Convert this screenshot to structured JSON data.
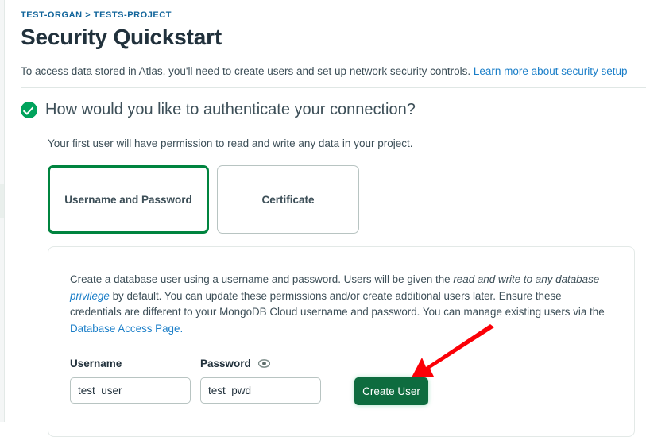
{
  "breadcrumb": {
    "text": "TEST-ORGAN > TESTS-PROJECT",
    "org": "TEST-ORGAN",
    "separator": ">",
    "project": "TESTS-PROJECT",
    "color": "#12659b"
  },
  "header": {
    "title": "Security Quickstart",
    "subtitle_text": "To access data stored in Atlas, you'll need to create users and set up network security controls.",
    "subtitle_link": "Learn more about security setup"
  },
  "section": {
    "status_icon": "check-circle-icon",
    "status_color": "#00a35c",
    "title": "How would you like to authenticate your connection?",
    "description": "Your first user will have permission to read and write any data in your project."
  },
  "auth_options": [
    {
      "label": "Username and Password",
      "selected": true,
      "border_color": "#00843f"
    },
    {
      "label": "Certificate",
      "selected": false,
      "border_color": "#b8c4c2"
    }
  ],
  "panel": {
    "paragraph": {
      "part1": "Create a database user using a username and password. Users will be given the ",
      "italic_link_prefix": "read and write to any database ",
      "italic_link": "privilege",
      "part2": " by default. You can update these permissions and/or create additional users later. Ensure these credentials are different to your MongoDB Cloud username and password. You can manage existing users via the ",
      "link2": "Database Access Page.",
      "link_color": "#1a7ec8"
    },
    "form": {
      "username": {
        "label": "Username",
        "value": "test_user",
        "placeholder": ""
      },
      "password": {
        "label": "Password",
        "value": "test_pwd",
        "placeholder": "",
        "visibility_icon": "eye-icon"
      },
      "submit": {
        "label": "Create User",
        "color": "#0e6c3f"
      }
    }
  },
  "annotation": {
    "type": "arrow",
    "color": "#fb0007",
    "points_to": "create-user-button"
  }
}
